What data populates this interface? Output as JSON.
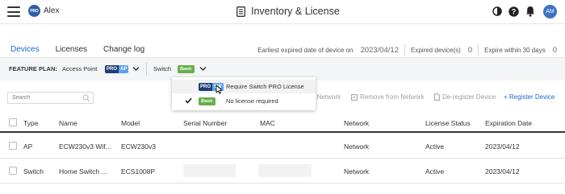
{
  "header": {
    "org_badge": "PRO",
    "org_name": "Alex",
    "page_title": "Inventory & License",
    "avatar_initials": "AM",
    "icons": [
      "menu-icon",
      "inventory-icon",
      "theme-contrast-icon",
      "help-icon",
      "notification-bell-icon"
    ]
  },
  "tabs": [
    {
      "label": "Devices",
      "active": true
    },
    {
      "label": "Licenses",
      "active": false
    },
    {
      "label": "Change log",
      "active": false
    }
  ],
  "summary": {
    "earliest_label": "Earliest expired date of device on",
    "earliest_value": "2023/04/12",
    "expired_label": "Expired device(s)",
    "expired_value": "0",
    "expire30_label": "Expire within 30 days",
    "expire30_value": "0"
  },
  "feature_plan": {
    "label": "FEATURE PLAN:",
    "ap_label": "Access Point",
    "ap_badge_pro": "PRO",
    "ap_badge_type": "AP",
    "switch_label": "Switch",
    "switch_badge": "Basic"
  },
  "dropdown": {
    "options": [
      {
        "badge_pro": "PRO",
        "badge_type": "SW",
        "label": "Require Switch PRO License",
        "selected": false
      },
      {
        "badge": "Basic",
        "label": "No license required",
        "selected": true
      }
    ]
  },
  "toolbar": {
    "search_placeholder": "Search",
    "hidden_prefix": "1",
    "move_label": "o Network",
    "remove_label": "Remove from Network",
    "deregister_label": "De-register Device",
    "register_label": "+ Register Device"
  },
  "table": {
    "columns": [
      "Type",
      "Name",
      "Model",
      "Serial Number",
      "MAC",
      "Network",
      "License Status",
      "Expiration Date"
    ],
    "rows": [
      {
        "type": "AP",
        "name": "ECW230v3 Wif...",
        "model": "ECW230v3",
        "network": "Network",
        "status": "Active",
        "expiration": "2023/04/12"
      },
      {
        "type": "Switch",
        "name": "Home Switch ...",
        "model": "ECS1008P",
        "network": "Network",
        "status": "Active",
        "expiration": "2023/04/12"
      }
    ]
  },
  "colors": {
    "accent": "#1b6ac9",
    "pro_dark": "#1f3f72",
    "pro_light": "#5ea0e6",
    "basic_green": "#66b04a",
    "avatar": "#3b73c4"
  }
}
